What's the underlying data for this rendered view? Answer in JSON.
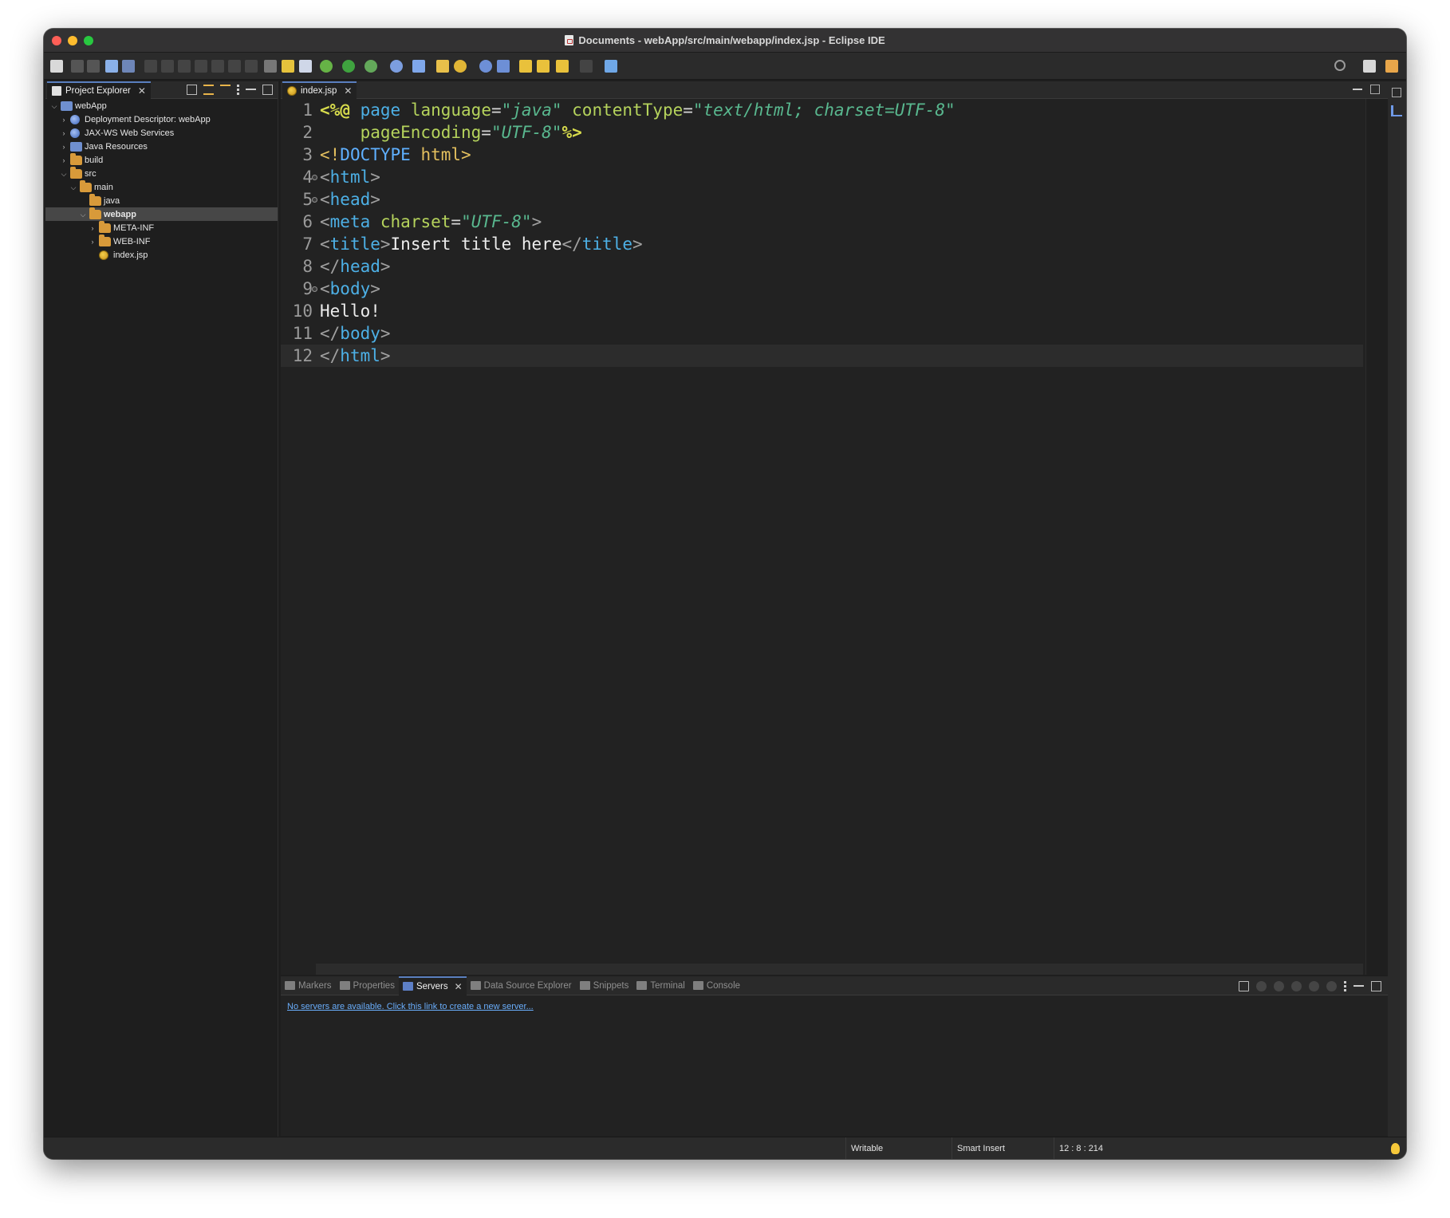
{
  "window": {
    "title": "Documents - webApp/src/main/webapp/index.jsp - Eclipse IDE"
  },
  "project_explorer": {
    "tab_label": "Project Explorer",
    "tree": [
      {
        "label": "webApp",
        "level": 0,
        "expanded": true,
        "icon": "project-icon"
      },
      {
        "label": "Deployment Descriptor: webApp",
        "level": 1,
        "expanded": false,
        "icon": "deployment-descriptor-icon"
      },
      {
        "label": "JAX-WS Web Services",
        "level": 1,
        "expanded": false,
        "icon": "web-services-icon"
      },
      {
        "label": "Java Resources",
        "level": 1,
        "expanded": false,
        "icon": "java-resources-icon"
      },
      {
        "label": "build",
        "level": 1,
        "expanded": false,
        "icon": "folder-icon"
      },
      {
        "label": "src",
        "level": 1,
        "expanded": true,
        "icon": "folder-icon"
      },
      {
        "label": "main",
        "level": 2,
        "expanded": true,
        "icon": "folder-icon"
      },
      {
        "label": "java",
        "level": 3,
        "expanded": null,
        "icon": "folder-icon"
      },
      {
        "label": "webapp",
        "level": 3,
        "expanded": true,
        "icon": "folder-icon",
        "selected": true
      },
      {
        "label": "META-INF",
        "level": 4,
        "expanded": false,
        "icon": "folder-icon"
      },
      {
        "label": "WEB-INF",
        "level": 4,
        "expanded": false,
        "icon": "folder-icon"
      },
      {
        "label": "index.jsp",
        "level": 4,
        "expanded": null,
        "icon": "jsp-file-icon"
      }
    ]
  },
  "editor": {
    "tab_label": "index.jsp",
    "current_line": 12,
    "lines": [
      {
        "n": "1",
        "fold": false
      },
      {
        "n": "2",
        "fold": false
      },
      {
        "n": "3",
        "fold": false
      },
      {
        "n": "4",
        "fold": true
      },
      {
        "n": "5",
        "fold": true
      },
      {
        "n": "6",
        "fold": false
      },
      {
        "n": "7",
        "fold": false
      },
      {
        "n": "8",
        "fold": false
      },
      {
        "n": "9",
        "fold": true
      },
      {
        "n": "10",
        "fold": false
      },
      {
        "n": "11",
        "fold": false
      },
      {
        "n": "12",
        "fold": false
      }
    ],
    "code": {
      "l1": {
        "open": "<%@",
        "kw": "page",
        "a1": "language",
        "v1": "\"java\"",
        "a2": "contentType",
        "v2": "\"text/html; charset=UTF-8\""
      },
      "l2": {
        "a1": "pageEncoding",
        "v1": "\"UTF-8\"",
        "close": "%>"
      },
      "l3": {
        "open": "<!",
        "kw": "DOCTYPE",
        "rest": "html",
        "close": ">"
      },
      "l4": {
        "tag": "html"
      },
      "l5": {
        "tag": "head"
      },
      "l6": {
        "tag": "meta",
        "attr": "charset",
        "val": "\"UTF-8\""
      },
      "l7": {
        "tag": "title",
        "text": "Insert title here"
      },
      "l8": {
        "tag": "head"
      },
      "l9": {
        "tag": "body"
      },
      "l10": {
        "text": "Hello!"
      },
      "l11": {
        "tag": "body"
      },
      "l12": {
        "tag": "html"
      }
    }
  },
  "bottom_panel": {
    "tabs": [
      {
        "label": "Markers",
        "active": false
      },
      {
        "label": "Properties",
        "active": false
      },
      {
        "label": "Servers",
        "active": true
      },
      {
        "label": "Data Source Explorer",
        "active": false
      },
      {
        "label": "Snippets",
        "active": false
      },
      {
        "label": "Terminal",
        "active": false
      },
      {
        "label": "Console",
        "active": false
      }
    ],
    "servers_message": "No servers are available. Click this link to create a new server..."
  },
  "status_bar": {
    "writable": "Writable",
    "insert_mode": "Smart Insert",
    "position": "12 : 8 : 214"
  },
  "colors": {
    "accent": "#5a7fbf",
    "link": "#6aaefc",
    "tag": "#4db0e6",
    "attribute": "#b5d35c",
    "string": "#59b88f"
  }
}
